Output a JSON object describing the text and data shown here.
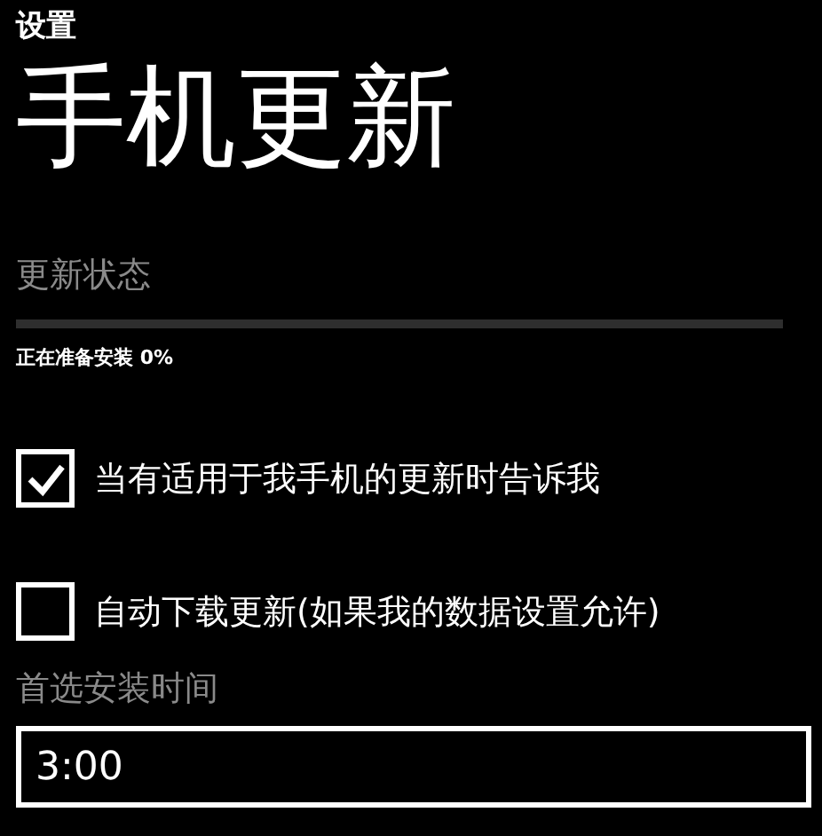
{
  "app_title": "设置",
  "page_title": "手机更新",
  "update_status": {
    "label": "更新状态",
    "level": 0,
    "message": "正在准备安装 0%"
  },
  "options": [
    {
      "label": "当有适用于我手机的更新时告诉我",
      "checked": true
    },
    {
      "label": "自动下载更新(如果我的数据设置允许)",
      "checked": false
    }
  ],
  "install_time": {
    "label": "首选安装时间",
    "value": "3:00"
  }
}
